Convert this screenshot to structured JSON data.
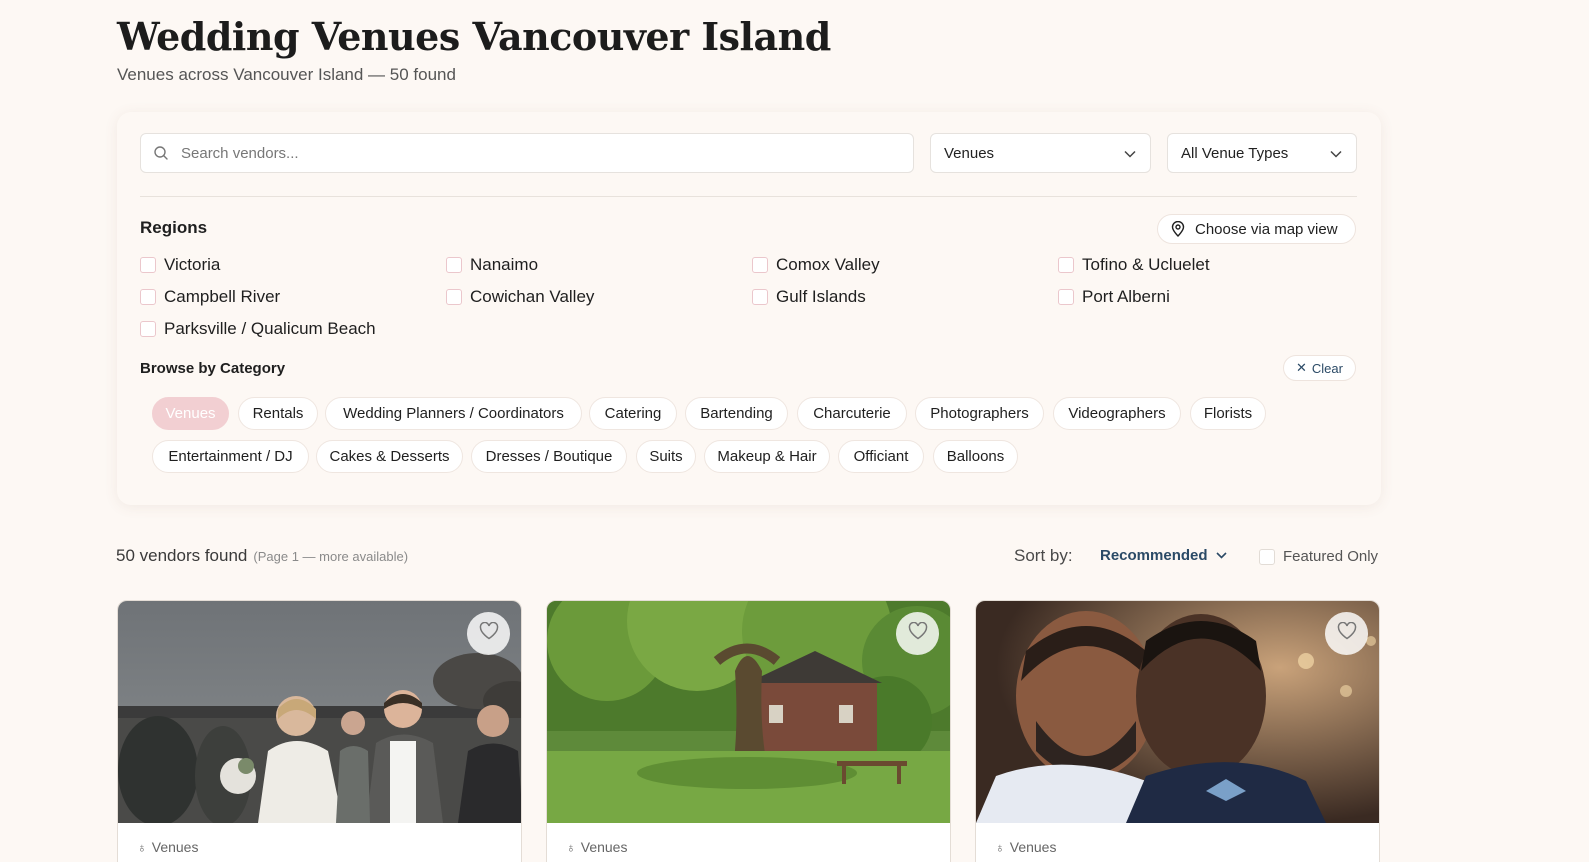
{
  "header": {
    "title": "Wedding Venues Vancouver Island",
    "subtitle": "Venues across Vancouver Island — 50 found"
  },
  "filters": {
    "search_placeholder": "Search vendors...",
    "category_select": "Venues",
    "venue_type_select": "All Venue Types",
    "regions_title": "Regions",
    "map_button": "Choose via map view",
    "regions": [
      "Victoria",
      "Nanaimo",
      "Comox Valley",
      "Tofino & Ucluelet",
      "Campbell River",
      "Cowichan Valley",
      "Gulf Islands",
      "Port Alberni",
      "Parksville / Qualicum Beach"
    ],
    "browse_title": "Browse by Category",
    "clear_label": "Clear",
    "categories": [
      "Venues",
      "Rentals",
      "Wedding Planners / Coordinators",
      "Catering",
      "Bartending",
      "Charcuterie",
      "Photographers",
      "Videographers",
      "Florists",
      "Entertainment / DJ",
      "Cakes & Desserts",
      "Dresses / Boutique",
      "Suits",
      "Makeup & Hair",
      "Officiant",
      "Balloons"
    ],
    "active_category": "Venues"
  },
  "results": {
    "count_text": "50 vendors found",
    "page_note": "(Page 1 — more available)",
    "sort_label": "Sort by:",
    "sort_value": "Recommended",
    "featured_only": "Featured Only"
  },
  "cards": [
    {
      "category": "Venues",
      "icon": "heart-icon"
    },
    {
      "category": "Venues",
      "icon": "heart-icon"
    },
    {
      "category": "Venues",
      "icon": "heart-icon"
    }
  ],
  "colors": {
    "background": "#fdf8f4",
    "accent": "#2b4a66",
    "active_chip": "#f2cfd2",
    "checkbox_border": "#ebc7cc"
  }
}
